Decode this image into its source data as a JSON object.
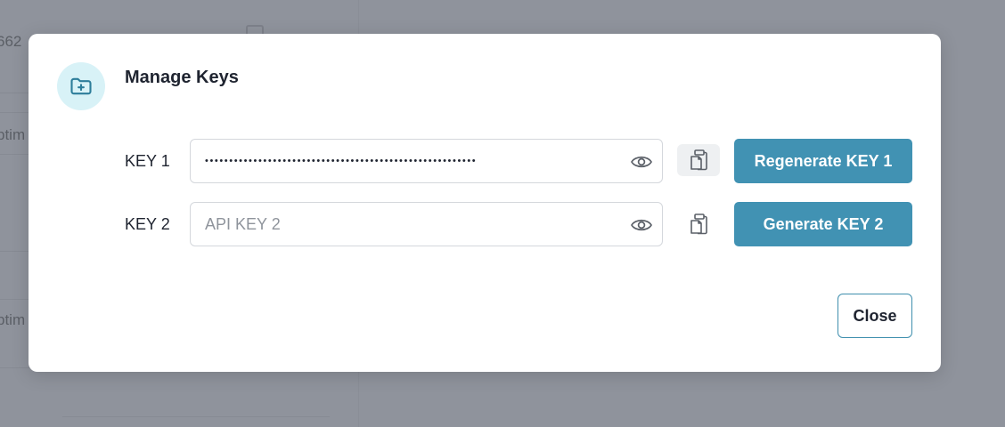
{
  "background": {
    "fragments": [
      "662",
      "ptim",
      "ptim"
    ]
  },
  "modal": {
    "icon": "folder-plus-icon",
    "title": "Manage Keys",
    "keys": [
      {
        "label": "KEY 1",
        "value": "••••••••••••••••••••••••••••••••••••••••••••••••••••••••",
        "placeholder": "",
        "action_label": "Regenerate KEY 1"
      },
      {
        "label": "KEY 2",
        "value": "",
        "placeholder": "API KEY 2",
        "action_label": "Generate KEY 2"
      }
    ],
    "close_label": "Close"
  },
  "colors": {
    "accent": "#4192b3",
    "icon_bg": "#d8f2f7",
    "overlay": "#8f939c"
  }
}
